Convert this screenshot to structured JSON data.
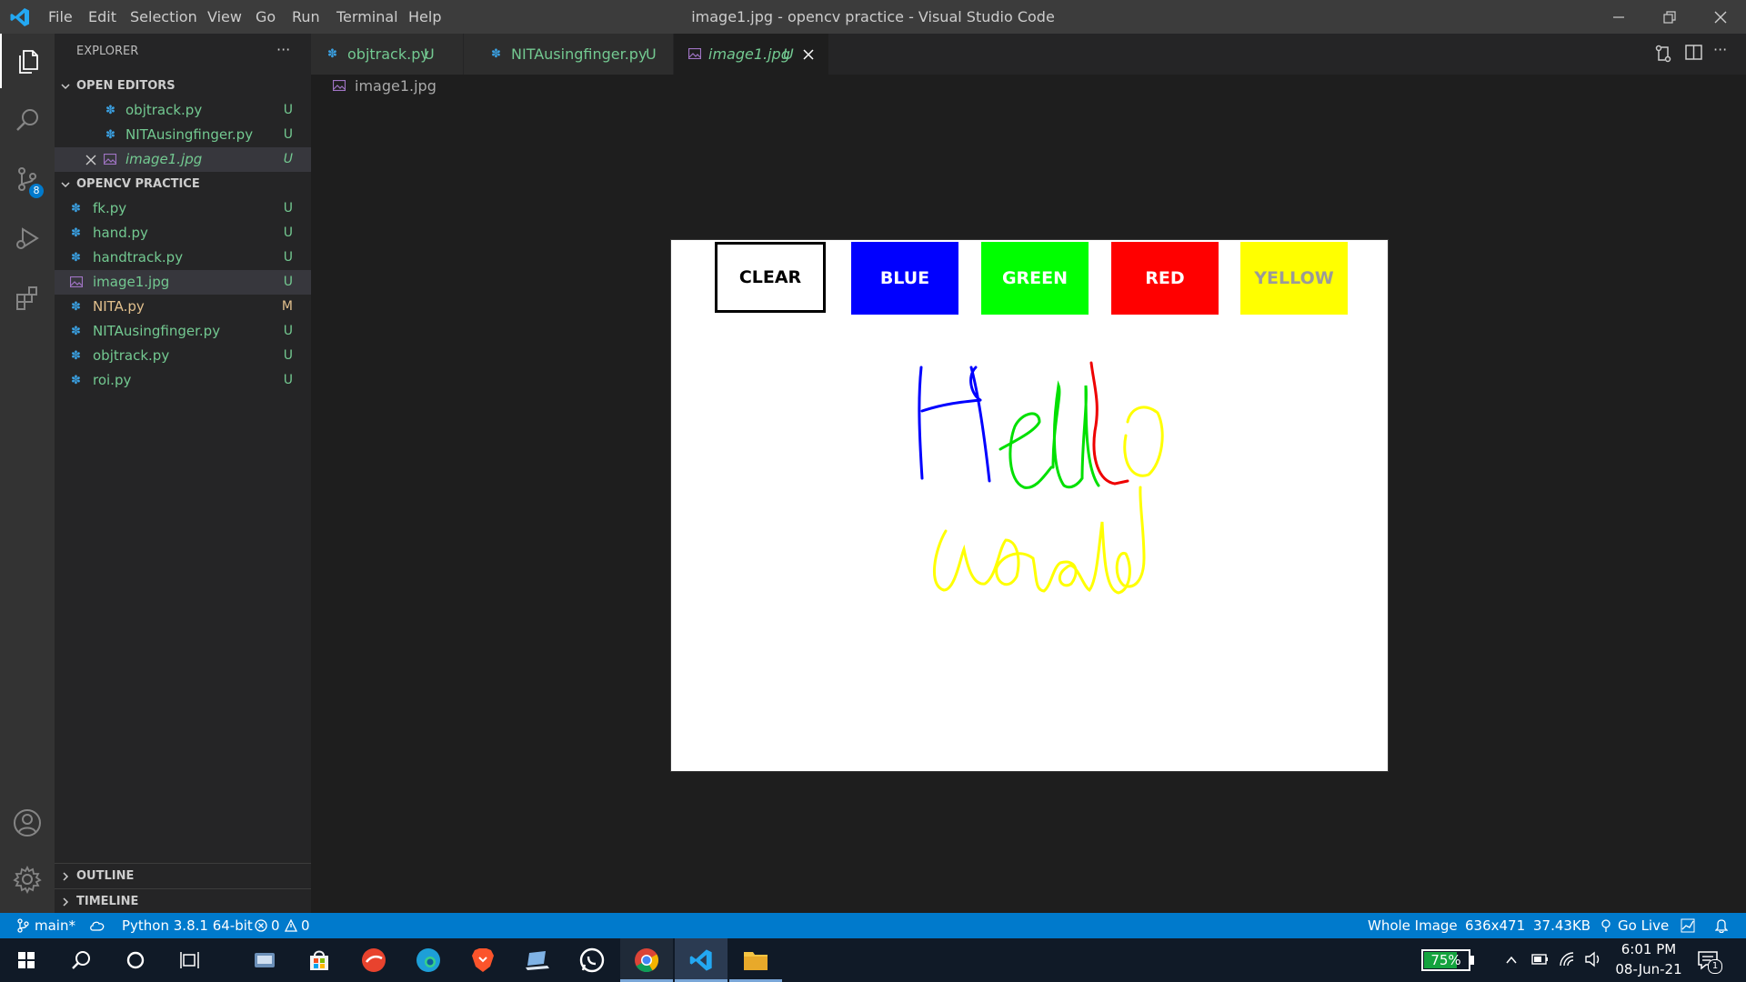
{
  "titlebar": {
    "title": "image1.jpg - opencv practice - Visual Studio Code",
    "menu": [
      "File",
      "Edit",
      "Selection",
      "View",
      "Go",
      "Run",
      "Terminal",
      "Help"
    ]
  },
  "activitybar": {
    "scm_badge": "8"
  },
  "sidebar": {
    "header": "EXPLORER",
    "more": "···",
    "open_editors_title": "OPEN EDITORS",
    "open_editors": [
      {
        "name": "objtrack.py",
        "status": "U"
      },
      {
        "name": "NITAusingfinger.py",
        "status": "U"
      },
      {
        "name": "image1.jpg",
        "status": "U"
      }
    ],
    "folder_title": "OPENCV PRACTICE",
    "files": [
      {
        "name": "fk.py",
        "status": "U"
      },
      {
        "name": "hand.py",
        "status": "U"
      },
      {
        "name": "handtrack.py",
        "status": "U"
      },
      {
        "name": "image1.jpg",
        "status": "U"
      },
      {
        "name": "NITA.py",
        "status": "M"
      },
      {
        "name": "NITAusingfinger.py",
        "status": "U"
      },
      {
        "name": "objtrack.py",
        "status": "U"
      },
      {
        "name": "roi.py",
        "status": "U"
      }
    ],
    "outline": "OUTLINE",
    "timeline": "TIMELINE"
  },
  "tabs": [
    {
      "label": "objtrack.py",
      "status": "U"
    },
    {
      "label": "NITAusingfinger.py",
      "status": "U"
    },
    {
      "label": "image1.jpg",
      "status": "U"
    }
  ],
  "breadcrumb": "image1.jpg",
  "image": {
    "buttons": [
      {
        "label": "CLEAR",
        "color": "#ffffff",
        "text_color": "#000000"
      },
      {
        "label": "BLUE",
        "color": "#0000ff",
        "text_color": "#ffffff"
      },
      {
        "label": "GREEN",
        "color": "#00ff00",
        "text_color": "#ffffff"
      },
      {
        "label": "RED",
        "color": "#ff0000",
        "text_color": "#ffffff"
      },
      {
        "label": "YELLOW",
        "color": "#ffff00",
        "text_color": "#9a9a9a"
      }
    ]
  },
  "statusbar": {
    "branch": "main*",
    "python": "Python 3.8.1 64-bit",
    "errors": "0",
    "warnings": "0",
    "whole_image": "Whole Image",
    "dimensions": "636x471",
    "size": "37.43KB",
    "golive": "Go Live"
  },
  "taskbar": {
    "battery": "75%",
    "time": "6:01 PM",
    "date": "08-Jun-21",
    "notif_count": "1"
  },
  "colors": {
    "accent": "#007acc",
    "untracked": "#73c991",
    "modified": "#e2c08d"
  }
}
